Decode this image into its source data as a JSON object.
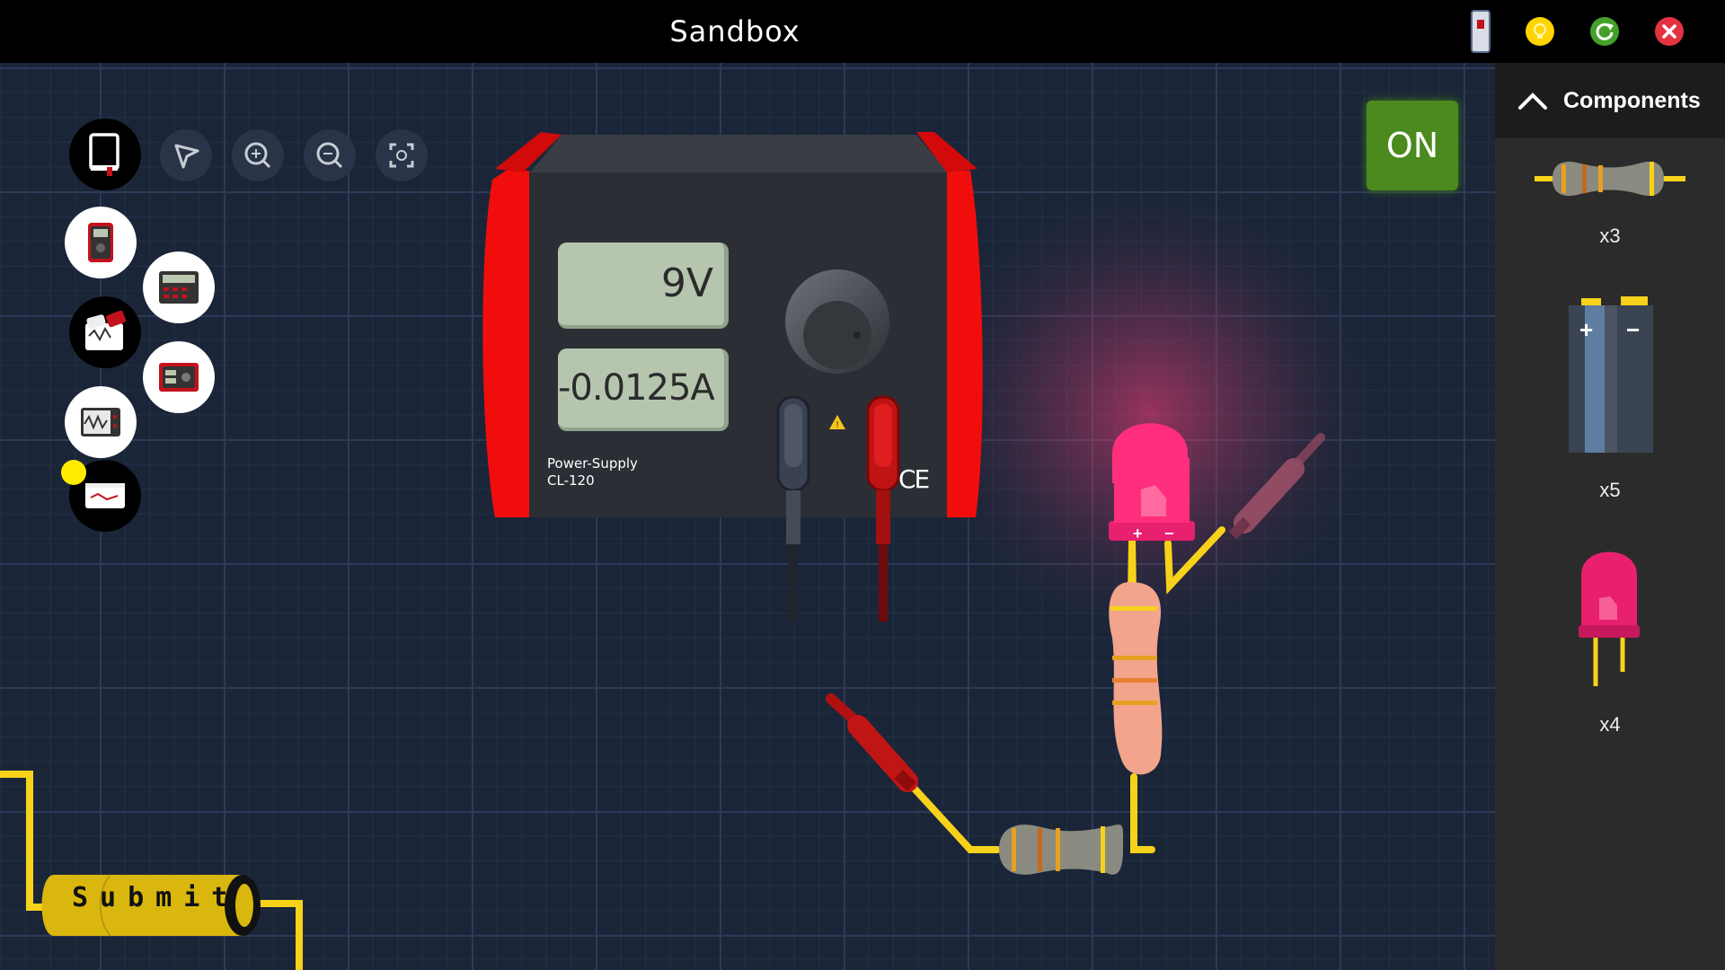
{
  "window": {
    "title": "Sandbox"
  },
  "power_supply": {
    "voltage_display": "9V",
    "current_display": "-0.0125A",
    "model_line1": "Power-Supply",
    "model_line2": "CL-120",
    "ce_mark": "CE"
  },
  "power_button": {
    "label": "ON"
  },
  "submit_button": {
    "label": "Submit"
  },
  "components_panel": {
    "title": "Components",
    "items": [
      {
        "name": "resistor",
        "count": "x3"
      },
      {
        "name": "battery",
        "count": "x5",
        "plus": "+",
        "minus": "−"
      },
      {
        "name": "led",
        "count": "x4"
      }
    ]
  },
  "led_terminals": {
    "plus": "+",
    "minus": "−"
  },
  "colors": {
    "frame_red": "#f20d0d",
    "led_pink": "#ff2f7d",
    "wire_yellow": "#f7d21a",
    "on_green": "#4a8a1e",
    "grid_bg": "#1b2538"
  }
}
